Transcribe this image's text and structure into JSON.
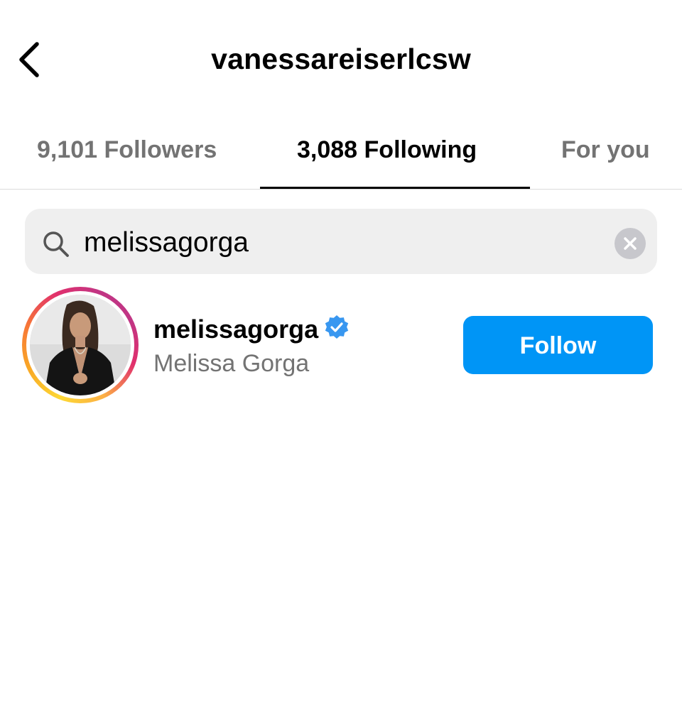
{
  "header": {
    "title": "vanessareiserlcsw"
  },
  "tabs": [
    {
      "label": "9,101 Followers",
      "active": false
    },
    {
      "label": "3,088 Following",
      "active": true
    },
    {
      "label": "For you",
      "active": false
    }
  ],
  "search": {
    "value": "melissagorga",
    "placeholder": "Search"
  },
  "results": [
    {
      "username": "melissagorga",
      "full_name": "Melissa Gorga",
      "verified": true,
      "has_story_ring": true,
      "button_label": "Follow"
    }
  ],
  "colors": {
    "accent": "#0095f6",
    "secondary_text": "#737373",
    "verified_badge": "#3897f0",
    "search_bg": "#efefef"
  },
  "icons": {
    "back": "chevron-left-icon",
    "search": "search-icon",
    "clear": "clear-icon",
    "verified": "verified-badge-icon"
  }
}
